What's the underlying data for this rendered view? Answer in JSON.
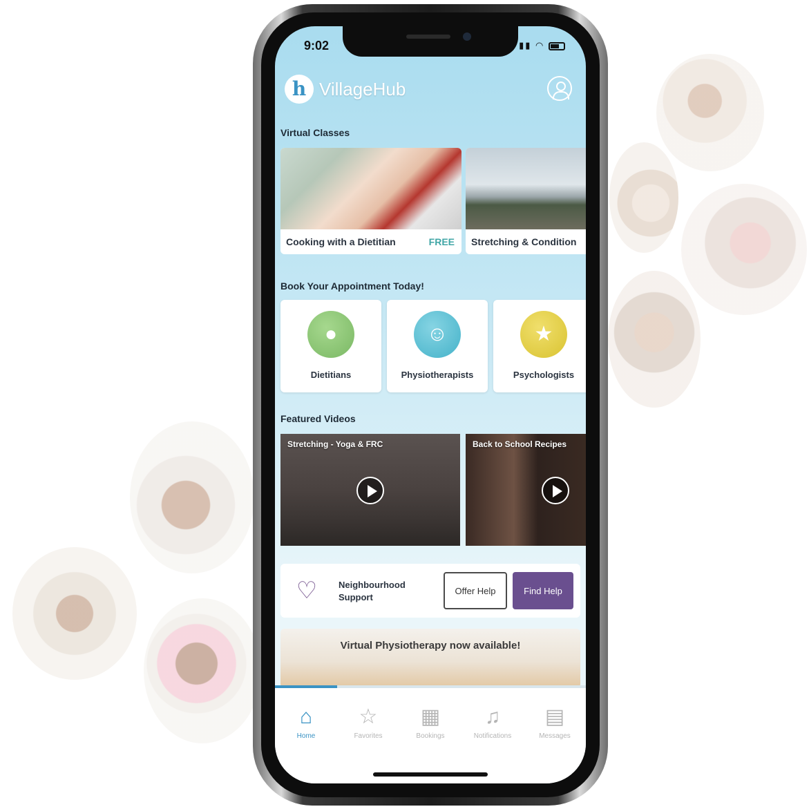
{
  "status_bar": {
    "time": "9:02"
  },
  "header": {
    "app_name": "VillageHub",
    "logo_letter": "h"
  },
  "virtual_classes": {
    "title": "Virtual Classes",
    "items": [
      {
        "label": "Cooking with a Dietitian",
        "badge": "FREE"
      },
      {
        "label": "Stretching & Condition"
      }
    ]
  },
  "appointments": {
    "title": "Book Your Appointment Today!",
    "items": [
      {
        "label": "Dietitians",
        "color": "#7ab864"
      },
      {
        "label": "Physiotherapists",
        "color": "#44b2c9"
      },
      {
        "label": "Psychologists",
        "color": "#d9c331"
      }
    ]
  },
  "featured_videos": {
    "title": "Featured Videos",
    "items": [
      {
        "title": "Stretching - Yoga & FRC"
      },
      {
        "title": "Back to School Recipes"
      }
    ]
  },
  "neighbourhood": {
    "label": "Neighbourhood Support",
    "offer_label": "Offer Help",
    "find_label": "Find Help",
    "accent": "#6a4f8f"
  },
  "banner": {
    "text": "Virtual Physiotherapy now available!",
    "carousel_progress": 0.2
  },
  "tabs": [
    {
      "label": "Home",
      "icon": "home-icon",
      "active": true
    },
    {
      "label": "Favorites",
      "icon": "star-icon",
      "active": false
    },
    {
      "label": "Bookings",
      "icon": "calendar-icon",
      "active": false
    },
    {
      "label": "Notifications",
      "icon": "bell-icon",
      "active": false
    },
    {
      "label": "Messages",
      "icon": "message-icon",
      "active": false
    }
  ]
}
